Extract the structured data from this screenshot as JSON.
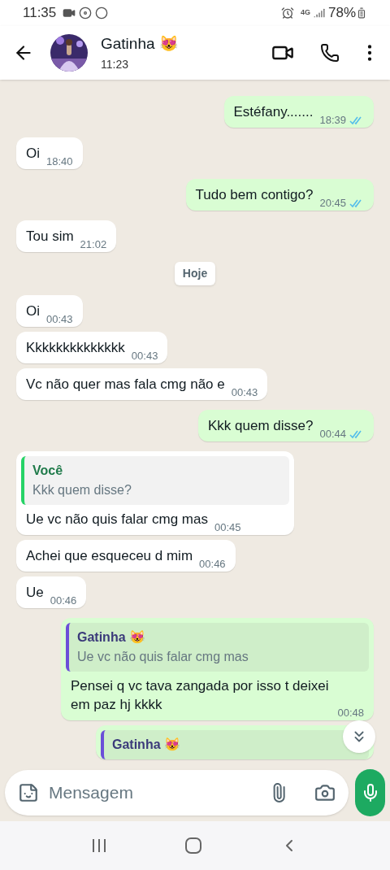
{
  "status_bar": {
    "time": "11:35",
    "network": "4G",
    "battery": "78%"
  },
  "header": {
    "name": "Gatinha 😻",
    "last_seen": "11:23"
  },
  "messages": [
    {
      "kind": "out",
      "text": "Estéfany.......",
      "time": "18:39",
      "read": true
    },
    {
      "kind": "in",
      "text": "Oi",
      "time": "18:40"
    },
    {
      "kind": "out",
      "text": "Tudo bem contigo?",
      "time": "20:45",
      "read": true
    },
    {
      "kind": "in",
      "text": "Tou sim",
      "time": "21:02"
    },
    {
      "kind": "date",
      "text": "Hoje"
    },
    {
      "kind": "in",
      "text": "Oi",
      "time": "00:43"
    },
    {
      "kind": "in",
      "text": "Kkkkkkkkkkkkkk",
      "time": "00:43"
    },
    {
      "kind": "in",
      "text": "Vc não quer mas fala cmg não e",
      "time": "00:43"
    },
    {
      "kind": "out",
      "text": "Kkk quem disse?",
      "time": "00:44",
      "read": true
    },
    {
      "kind": "in",
      "text": "Ue vc não quis falar cmg mas",
      "time": "00:45",
      "quote": {
        "author": "Você",
        "text": "Kkk quem disse?"
      }
    },
    {
      "kind": "in",
      "text": "Achei que esqueceu d mim",
      "time": "00:46"
    },
    {
      "kind": "in",
      "text": "Ue",
      "time": "00:46"
    },
    {
      "kind": "out",
      "text": "Pensei q vc tava zangada por isso t deixei em paz hj kkkk",
      "time": "00:48",
      "quote": {
        "author": "Gatinha 😻",
        "text": "Ue vc não quis falar cmg mas"
      }
    },
    {
      "kind": "out",
      "quote": {
        "author": "Gatinha 😻"
      }
    }
  ],
  "composer": {
    "placeholder": "Mensagem"
  }
}
